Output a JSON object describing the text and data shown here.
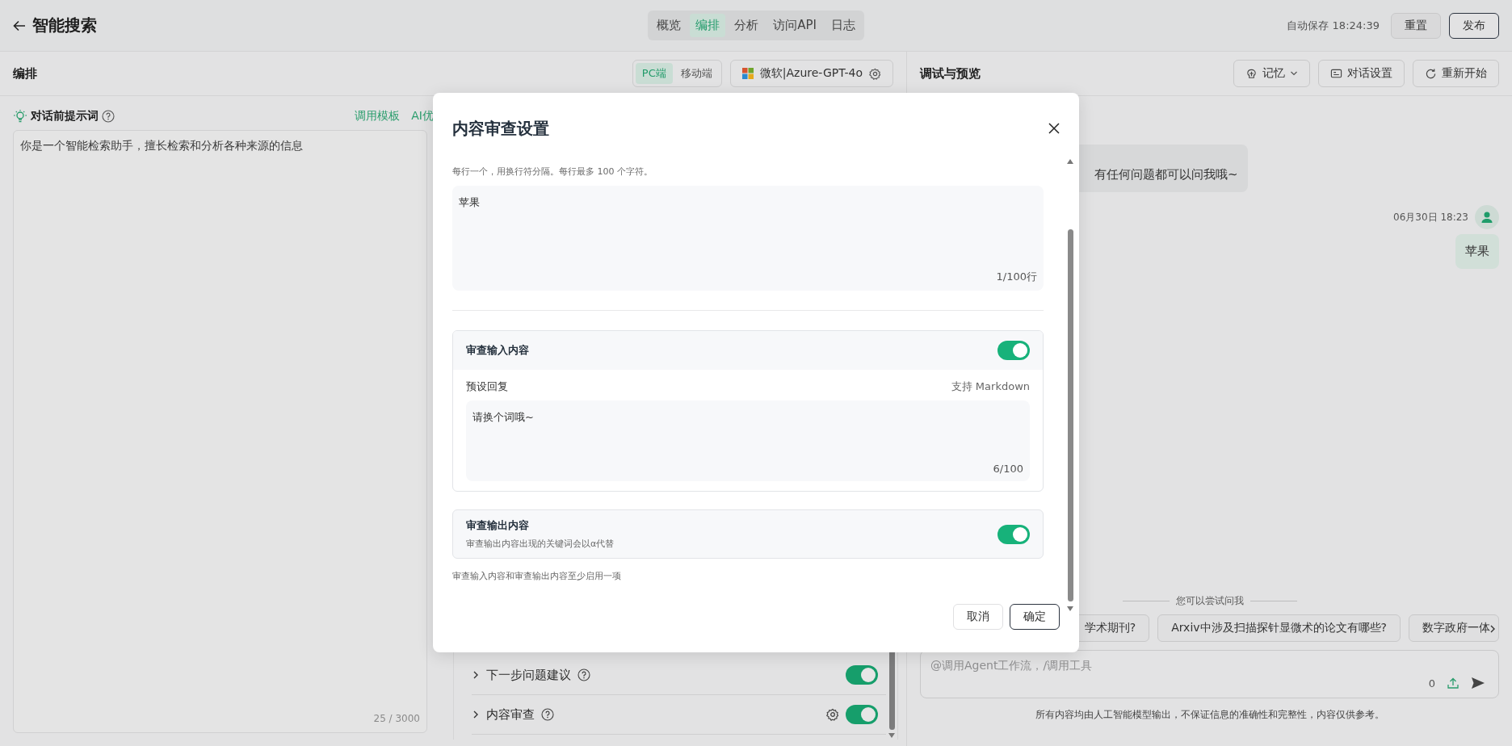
{
  "header": {
    "title": "智能搜索",
    "tabs": [
      {
        "label": "概览",
        "selected": false
      },
      {
        "label": "编排",
        "selected": true
      },
      {
        "label": "分析",
        "selected": false
      },
      {
        "label": "访问API",
        "selected": false
      },
      {
        "label": "日志",
        "selected": false
      }
    ],
    "autosave": "自动保存 18:24:39",
    "buttons": [
      {
        "label": "重置",
        "kind": "default"
      },
      {
        "label": "发布",
        "kind": "primary"
      }
    ]
  },
  "editor": {
    "title": "编排",
    "device_tabs": [
      {
        "label": "PC端",
        "selected": true
      },
      {
        "label": "移动端",
        "selected": false
      }
    ],
    "model": "微软|Azure-GPT-4o",
    "prompt": {
      "label": "对话前提示词",
      "links": [
        "调用模板",
        "AI优"
      ],
      "text": "你是一个智能检索助手，擅长检索和分析各种来源的信息",
      "count": "25 / 3000"
    }
  },
  "features": [
    {
      "label": "下一步问题建议",
      "settings": false,
      "on": true
    },
    {
      "label": "内容审查",
      "settings": true,
      "on": true
    }
  ],
  "preview": {
    "title": "调试与预览",
    "buttons": [
      {
        "label": "记忆",
        "kind": "memory"
      },
      {
        "label": "对话设置",
        "kind": "settings"
      },
      {
        "label": "重新开始",
        "kind": "restart"
      }
    ],
    "messages": [
      {
        "kind": "assistant",
        "text": "有任何问题都可以问我哦~"
      },
      {
        "kind": "user",
        "time": "06月30日 18:23",
        "text": "苹果"
      }
    ],
    "suggestions_title": "您可以尝试问我",
    "suggestions": [
      "学术期刊?",
      "Arxiv中涉及扫描探针显微术的论文有哪些?",
      "数字政府一体"
    ],
    "input": {
      "placeholder": "@调用Agent工作流，/调用工具",
      "count": "0"
    },
    "disclaimer": "所有内容均由人工智能模型输出，不保证信息的准确性和完整性，内容仅供参考。"
  },
  "dialog": {
    "title": "内容审查设置",
    "keywords": {
      "hint": "每行一个，用换行符分隔。每行最多 100 个字符。",
      "value": "苹果",
      "count": "1/100行"
    },
    "input_review": {
      "label": "审查输入内容",
      "on": true,
      "reply_label": "预设回复",
      "reply_note": "支持 Markdown",
      "reply": "请换个词哦~",
      "count": "6/100"
    },
    "output_review": {
      "label": "审查输出内容",
      "description": "审查输出内容出现的关键词会以α代替",
      "on": true
    },
    "note": "审查输入内容和审查输出内容至少启用一项",
    "buttons": [
      {
        "label": "取消",
        "kind": "default"
      },
      {
        "label": "确定",
        "kind": "primary"
      }
    ]
  }
}
